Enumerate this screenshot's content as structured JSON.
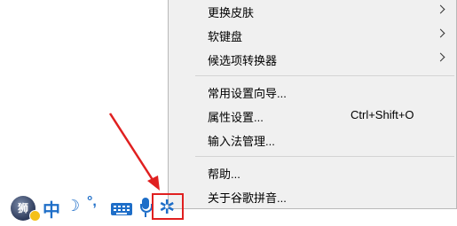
{
  "menu": {
    "items": [
      {
        "label": "更换皮肤",
        "submenu": true
      },
      {
        "label": "软键盘",
        "submenu": true
      },
      {
        "label": "候选项转换器",
        "submenu": true
      },
      {
        "label": "常用设置向导..."
      },
      {
        "label": "属性设置...",
        "shortcut": "Ctrl+Shift+O"
      },
      {
        "label": "输入法管理..."
      },
      {
        "label": "帮助..."
      },
      {
        "label": "关于谷歌拼音..."
      }
    ]
  },
  "langbar": {
    "logo_text": "狮",
    "mode_char": "中",
    "width_glyph": "☽",
    "punct_glyph": "°,",
    "gear_glyph": "✲",
    "tools": [
      "logo-icon",
      "chinese-mode-icon",
      "half-width-icon",
      "punctuation-icon",
      "keyboard-icon",
      "microphone-icon",
      "settings-gear-icon"
    ]
  },
  "colors": {
    "accent": "#1e6ec8",
    "highlight": "#e02020",
    "menu_bg": "#f0f0f0"
  }
}
